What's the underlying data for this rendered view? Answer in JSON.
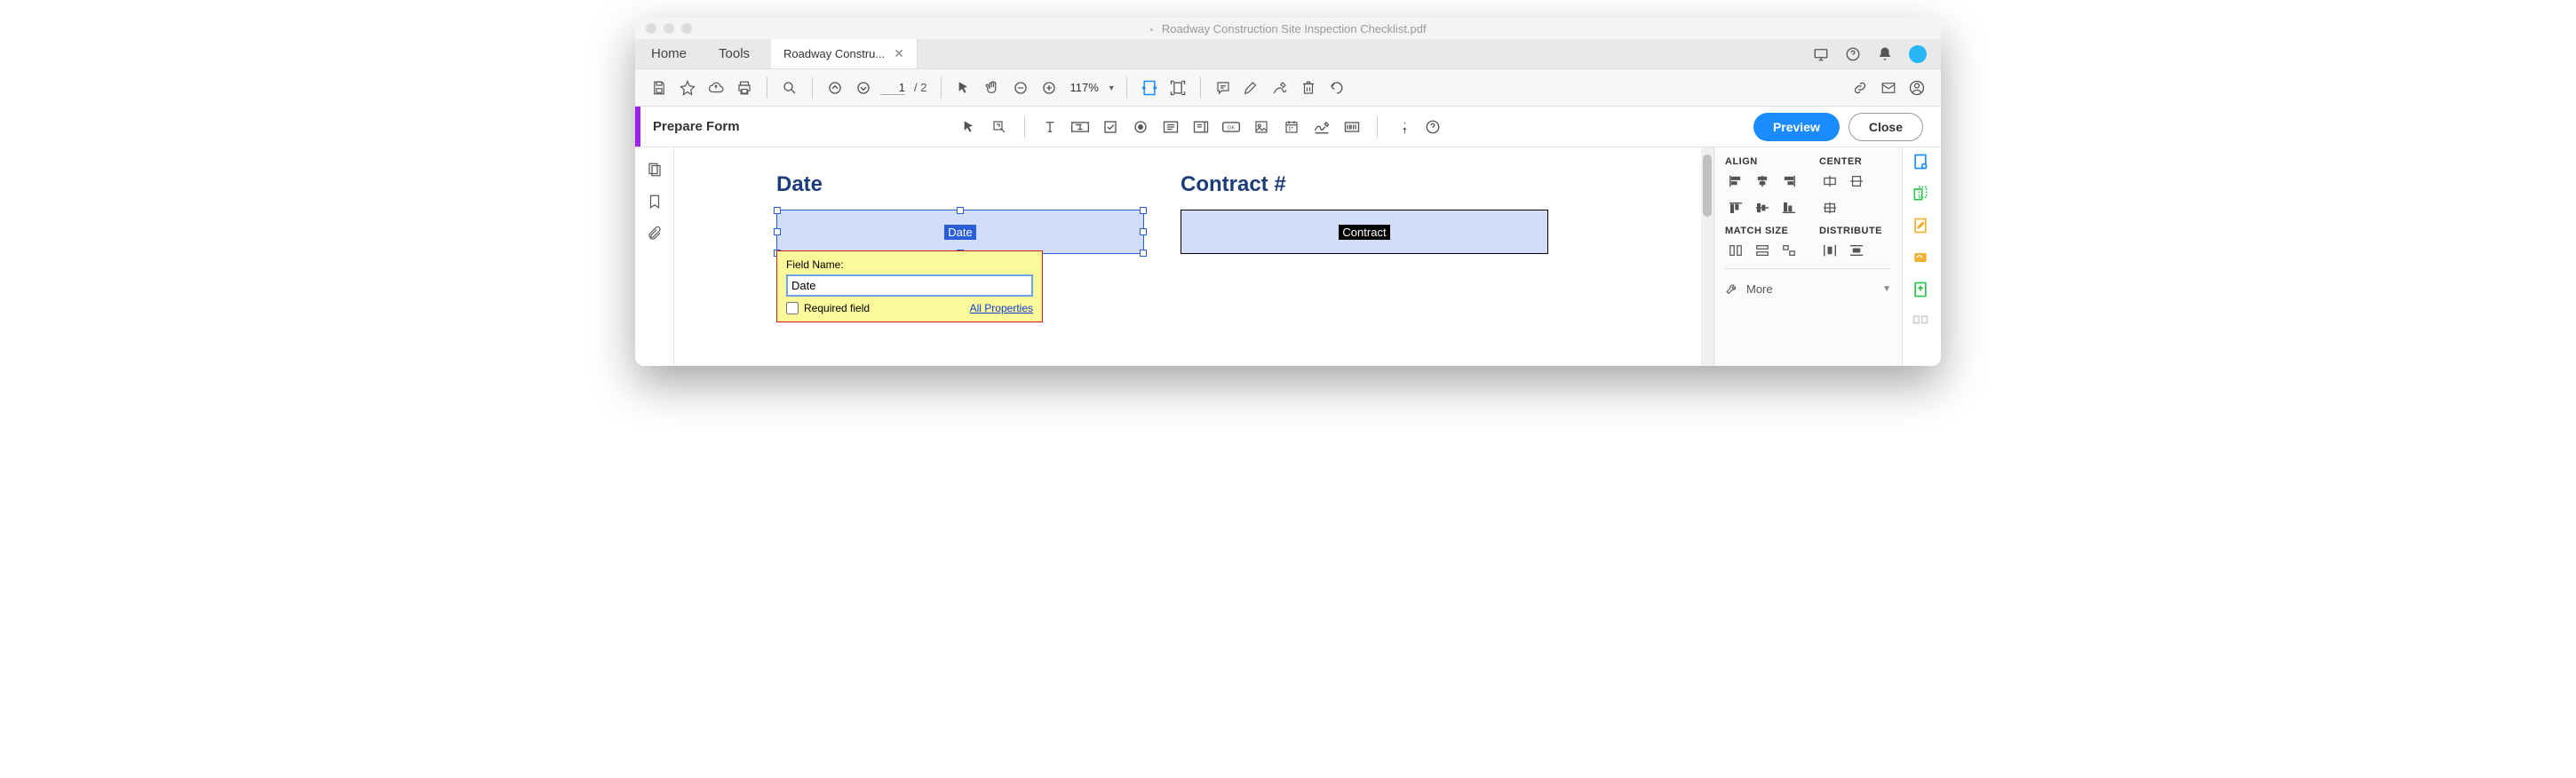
{
  "titlebar": {
    "title": "Roadway Construction Site Inspection Checklist.pdf"
  },
  "tabs": {
    "home": "Home",
    "tools": "Tools",
    "doc": "Roadway Constru..."
  },
  "toolbar": {
    "page_current": "1",
    "page_total": "/ 2",
    "zoom": "117%"
  },
  "formbar": {
    "label": "Prepare Form",
    "preview": "Preview",
    "close": "Close"
  },
  "doc": {
    "date_label": "Date",
    "date_field_name": "Date",
    "contract_label": "Contract #",
    "contract_field_name": "Contract"
  },
  "popup": {
    "field_name_label": "Field Name:",
    "field_name_value": "Date",
    "required_label": "Required field",
    "all_props": "All Properties"
  },
  "right_panel": {
    "align": "ALIGN",
    "center": "CENTER",
    "match": "MATCH SIZE",
    "distribute": "DISTRIBUTE",
    "more": "More"
  }
}
